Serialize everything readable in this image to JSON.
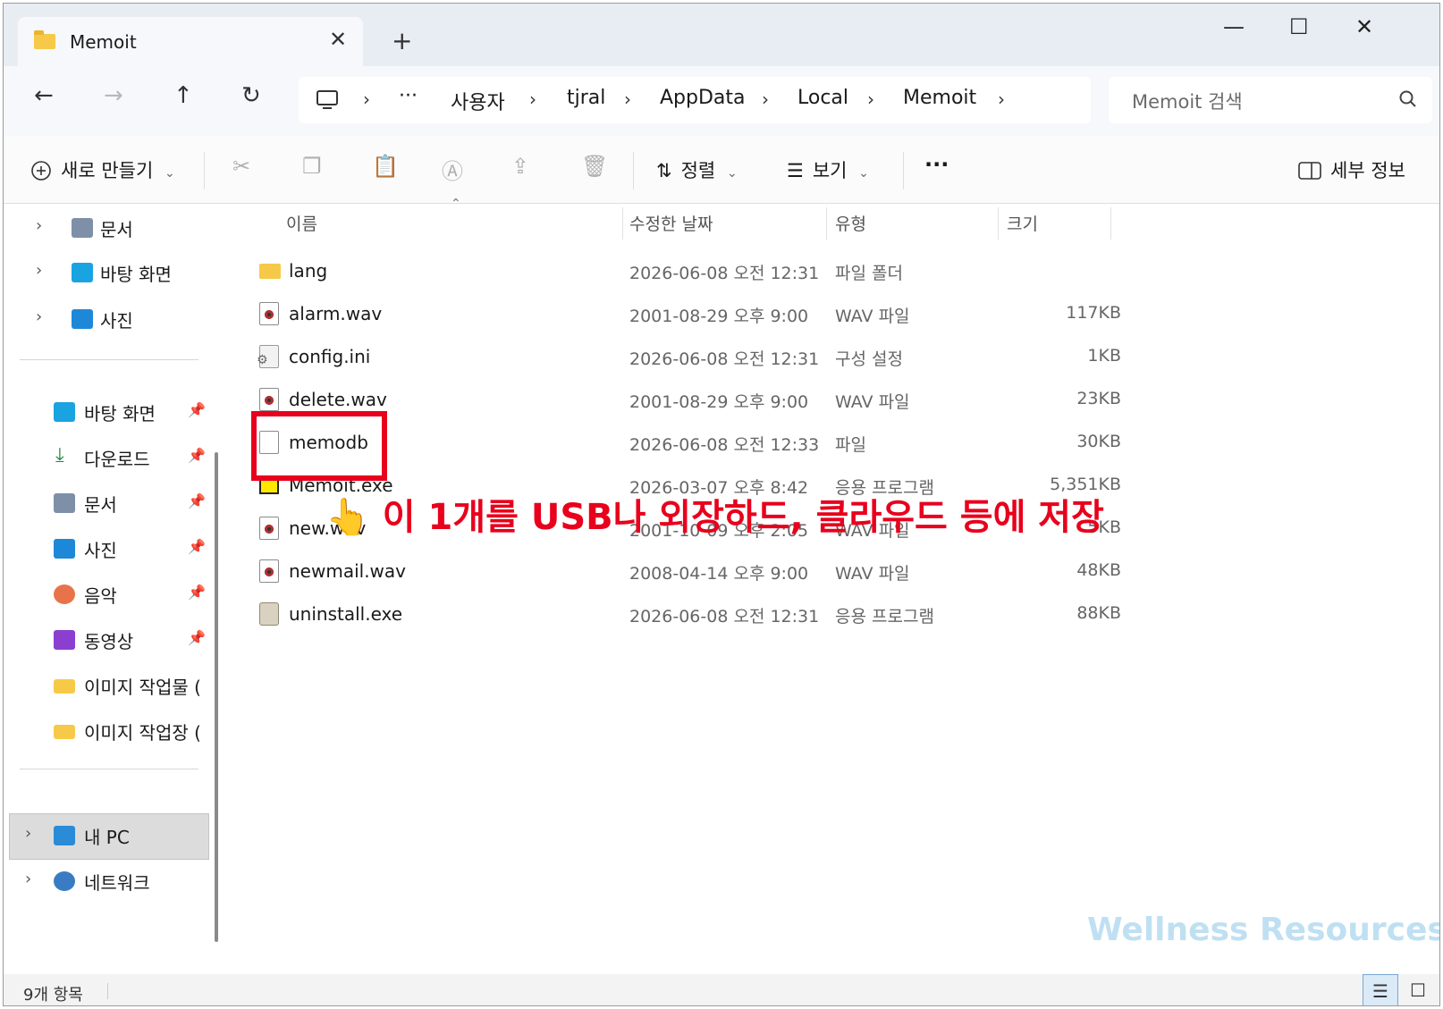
{
  "window": {
    "tab_title": "Memoit",
    "tab_close": "✕",
    "new_tab": "+",
    "minimize": "—",
    "maximize": "☐",
    "close": "✕"
  },
  "nav": {
    "back": "←",
    "forward": "→",
    "up": "↑",
    "refresh": "↻",
    "breadcrumb": [
      "사용자",
      "tjral",
      "AppData",
      "Local",
      "Memoit"
    ],
    "ellipsis": "···",
    "search_placeholder": "Memoit 검색"
  },
  "toolbar": {
    "new_label": "새로 만들기",
    "sort_label": "정렬",
    "view_label": "보기",
    "more": "···",
    "details_label": "세부 정보"
  },
  "sidebar": {
    "top_items": [
      {
        "label": "문서",
        "icon": "document-icon"
      },
      {
        "label": "바탕 화면",
        "icon": "desktop-icon"
      },
      {
        "label": "사진",
        "icon": "pictures-icon"
      }
    ],
    "quick_access": [
      {
        "label": "바탕 화면",
        "icon": "desktop-icon"
      },
      {
        "label": "다운로드",
        "icon": "download-icon"
      },
      {
        "label": "문서",
        "icon": "document-icon"
      },
      {
        "label": "사진",
        "icon": "pictures-icon"
      },
      {
        "label": "음악",
        "icon": "music-icon"
      },
      {
        "label": "동영상",
        "icon": "video-icon"
      },
      {
        "label": "이미지 작업물 (",
        "icon": "folder-icon"
      },
      {
        "label": "이미지 작업장 (",
        "icon": "folder-icon"
      }
    ],
    "this_pc": "내 PC",
    "network": "네트워크"
  },
  "columns": {
    "name": "이름",
    "date": "수정한 날짜",
    "type": "유형",
    "size": "크기"
  },
  "files": [
    {
      "name": "lang",
      "date": "2026-06-08 오전 12:31",
      "type": "파일 폴더",
      "size": "",
      "icon": "folder-icon"
    },
    {
      "name": "alarm.wav",
      "date": "2001-08-29 오후 9:00",
      "type": "WAV 파일",
      "size": "117KB",
      "icon": "audio-file-icon"
    },
    {
      "name": "config.ini",
      "date": "2026-06-08 오전 12:31",
      "type": "구성 설정",
      "size": "1KB",
      "icon": "settings-file-icon"
    },
    {
      "name": "delete.wav",
      "date": "2001-08-29 오후 9:00",
      "type": "WAV 파일",
      "size": "23KB",
      "icon": "audio-file-icon"
    },
    {
      "name": "memodb",
      "date": "2026-06-08 오전 12:33",
      "type": "파일",
      "size": "30KB",
      "icon": "blank-file-icon"
    },
    {
      "name": "Memoit.exe",
      "date": "2026-03-07 오후 8:42",
      "type": "응용 프로그램",
      "size": "5,351KB",
      "icon": "memoit-app-icon"
    },
    {
      "name": "new.wav",
      "date": "2001-10-09 오후 2:05",
      "type": "WAV 파일",
      "size": "5KB",
      "icon": "audio-file-icon"
    },
    {
      "name": "newmail.wav",
      "date": "2008-04-14 오후 9:00",
      "type": "WAV 파일",
      "size": "48KB",
      "icon": "audio-file-icon"
    },
    {
      "name": "uninstall.exe",
      "date": "2026-06-08 오전 12:31",
      "type": "응용 프로그램",
      "size": "88KB",
      "icon": "installer-icon"
    }
  ],
  "annotation": {
    "pointer": "👆",
    "text": "이 1개를 USB나 외장하드, 클라우드 등에 저장",
    "color": "#e8001c"
  },
  "watermark": "Wellness Resources",
  "status": {
    "item_count": "9개 항목"
  }
}
